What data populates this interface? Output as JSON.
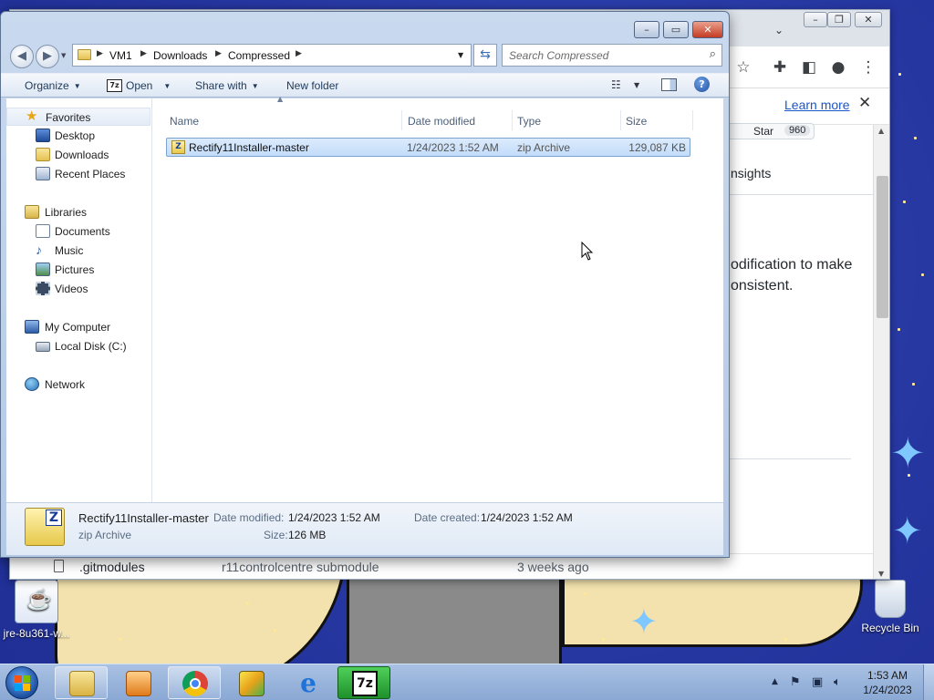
{
  "explorer": {
    "breadcrumb": [
      "VM1",
      "Downloads",
      "Compressed"
    ],
    "search_placeholder": "Search Compressed",
    "toolbar": {
      "organize": "Organize",
      "open": "Open",
      "share_with": "Share with",
      "new_folder": "New folder"
    },
    "nav": {
      "favorites": "Favorites",
      "desktop": "Desktop",
      "downloads": "Downloads",
      "recent_places": "Recent Places",
      "libraries": "Libraries",
      "documents": "Documents",
      "music": "Music",
      "pictures": "Pictures",
      "videos": "Videos",
      "my_computer": "My Computer",
      "local_disk": "Local Disk (C:)",
      "network": "Network"
    },
    "columns": {
      "name": "Name",
      "date_modified": "Date modified",
      "type": "Type",
      "size": "Size"
    },
    "files": [
      {
        "name": "Rectify11Installer-master",
        "date_modified": "1/24/2023 1:52 AM",
        "type": "zip Archive",
        "size": "129,087 KB"
      }
    ],
    "details": {
      "name": "Rectify11Installer-master",
      "type": "zip Archive",
      "date_modified_label": "Date modified:",
      "date_modified": "1/24/2023 1:52 AM",
      "date_created_label": "Date created:",
      "date_created": "1/24/2023 1:52 AM",
      "size_label": "Size:",
      "size": "126 MB"
    }
  },
  "browser": {
    "learn_more": "Learn more",
    "star_label": "Star",
    "star_count": "960",
    "insights": "nsights",
    "desc_line1": "odification to make",
    "desc_line2": "onsistent.",
    "row_name": ".gitmodules",
    "row_message": "r11controlcentre submodule",
    "row_age": "3 weeks ago"
  },
  "desktop": {
    "icon_java": "jre-8u361-w...",
    "icon_recycle": "Recycle Bin"
  },
  "taskbar": {
    "time": "1:53 AM",
    "date": "1/24/2023"
  },
  "colors": {
    "desktop_blue": "#2a3fa3",
    "selection": "#c2dcfa",
    "link": "#1a56c7"
  }
}
